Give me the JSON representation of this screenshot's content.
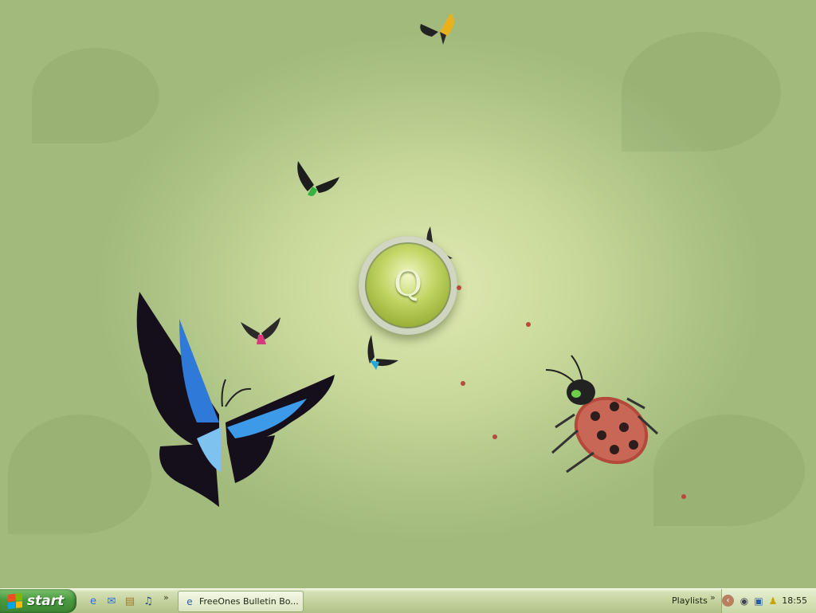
{
  "desktop": {
    "wallpaper": "green leaf texture with butterflies and ladybug",
    "center_logo_letter": "Q",
    "colors": {
      "wallpaper": "#c8d89a",
      "accent": "#9bb23a"
    }
  },
  "taskbar": {
    "start_label": "start",
    "quick_launch": [
      "internet-explorer-icon",
      "messenger-icon",
      "folder-icon",
      "media-icon"
    ],
    "overflow": "»",
    "active_task": {
      "label": "FreeOnes Bulletin Bo...",
      "icon": "internet-explorer-icon"
    },
    "toolbar_label": "Playlists",
    "toolbar_overflow": "»",
    "tray_icons": [
      "expand-tray-icon",
      "network-icon",
      "display-icon",
      "messenger-status-icon"
    ],
    "clock": "18:55"
  }
}
